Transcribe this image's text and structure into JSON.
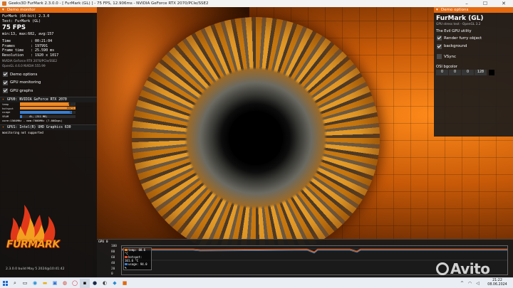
{
  "window": {
    "title": "Geeks3D FurMark 2.3.0.0 - [ FurMark (GL) ] - 75 FPS, 12.906ms - NVIDIA GeForce RTX 2070/PCIe/SSE2",
    "controls": [
      "–",
      "☐",
      "✕"
    ]
  },
  "left_panel": {
    "header": "Demo monitor",
    "app_line": "FurMark (64-bit) 2.3.0",
    "test_line": "Test: FurMark (GL)",
    "fps": "75 FPS",
    "fps_stats": "min:13, max:602, avg:157",
    "stats": [
      {
        "label": "Time",
        "value": ": 00:21:04"
      },
      {
        "label": "Frames",
        "value": ": 197991"
      },
      {
        "label": "Frame time",
        "value": ": 25.590 ms"
      },
      {
        "label": "Resolution",
        "value": ": 1920 x 1017"
      }
    ],
    "renderer": "NVIDIA GeForce RTX 2070/PCIe/SSE2",
    "opengl": "OpenGL 4.6.0 NVIDIA 555.99",
    "options": [
      {
        "label": "Demo options",
        "checked": true
      },
      {
        "label": "GPU monitoring",
        "checked": true
      },
      {
        "label": "GPU graphs",
        "checked": true
      }
    ],
    "gpu0_header": "GPU0: NVIDIA GeForce RTX 2070",
    "gpu0_bars": [
      {
        "label": "temp",
        "value": "89°C",
        "fraction": 0.89,
        "color": "#f08a24"
      },
      {
        "label": "hotspot",
        "value": "102°C",
        "fraction": 1.0,
        "color": "#f08a24"
      },
      {
        "label": "usage",
        "value": "94%",
        "fraction": 0.94,
        "color": "#3a7fd0"
      },
      {
        "label": "VRAM",
        "value": "4%, (311 MB)",
        "fraction": 0.04,
        "color": "#3a7fd0"
      }
    ],
    "gpu0_clock": "core:1564MHz - mem:7000MHz (7.00Gbps)",
    "gpu1_header": "GPU1: Intel(R) UHD Graphics 630",
    "gpu1_status": "monitoring not supported"
  },
  "logo": {
    "word": "FURMARK"
  },
  "version_line": "2.3.0.0 build May  5 2024@10:41:42",
  "right_panel": {
    "header": "Demo options",
    "app_name": "FurMark (GL)",
    "subtitle": "GPU stress test - OpenGL 3.2",
    "utility": "The Evil GPU utility",
    "options": [
      {
        "label": "Render furry object",
        "checked": true
      },
      {
        "label": "background",
        "checked": true
      },
      {
        "label": "VSync",
        "checked": false
      }
    ],
    "bg_label": "OSI bgcolor",
    "bg_values": [
      "0",
      "0",
      "0",
      "128"
    ],
    "bg_swatch": "#000000"
  },
  "graph": {
    "title": "GPU 0",
    "y_ticks": [
      "100",
      "80",
      "60",
      "40",
      "20",
      "0"
    ],
    "legend": [
      {
        "label": "temp: 88.6 °C",
        "color": "#f08a24"
      },
      {
        "label": "hotspot: 101.6 °C",
        "color": "#e05030"
      },
      {
        "label": "usage: 94.0 %",
        "color": "#3a7fd0"
      }
    ]
  },
  "watermark": "Avito",
  "taskbar": {
    "icons": [
      "search-icon",
      "task-view-icon",
      "edge-icon",
      "file-explorer-icon",
      "store-icon",
      "chrome-icon",
      "opera-icon",
      "furmark-icon",
      "steam-icon",
      "media-icon",
      "paint-icon",
      "app-icon"
    ],
    "time": "21:22",
    "date": "08.06.2024"
  }
}
